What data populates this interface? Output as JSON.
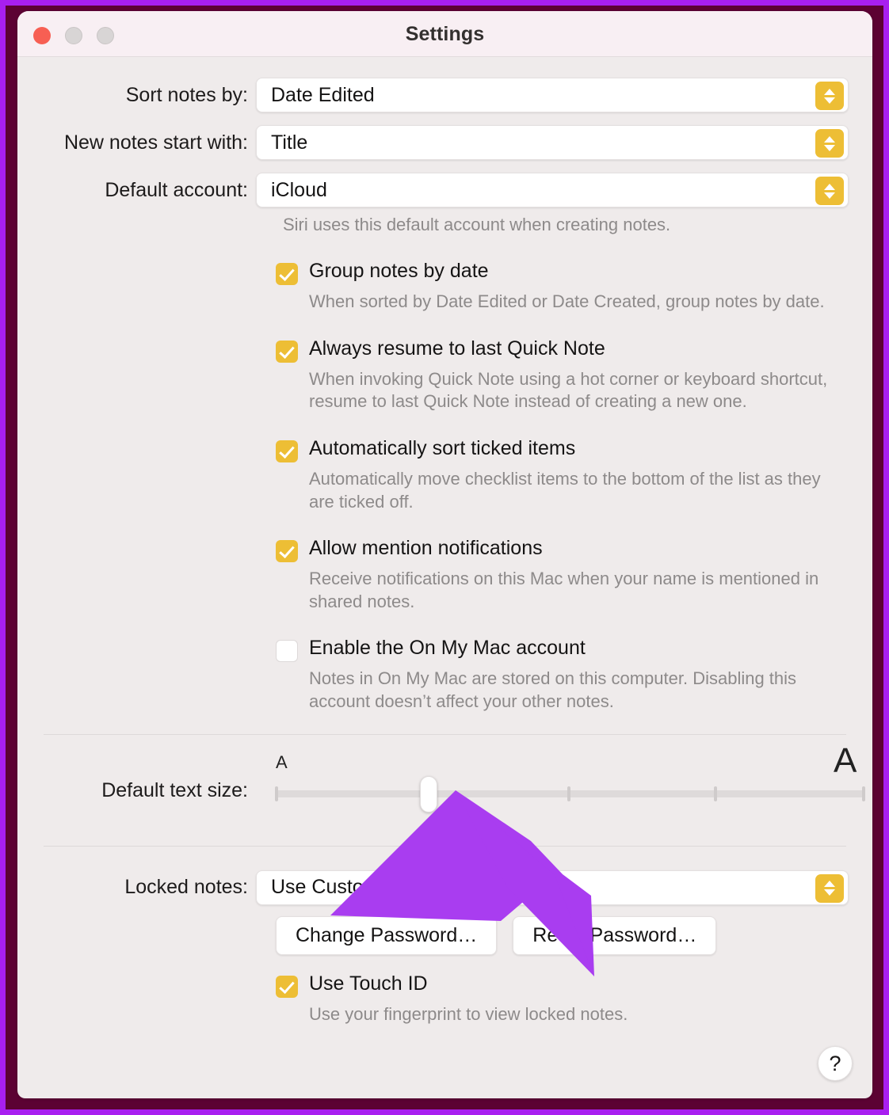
{
  "window": {
    "title": "Settings",
    "traffic_lights": [
      "close",
      "minimize",
      "maximize"
    ]
  },
  "popups": [
    {
      "label": "Sort notes by:",
      "value": "Date Edited"
    },
    {
      "label": "New notes start with:",
      "value": "Title"
    },
    {
      "label": "Default account:",
      "value": "iCloud"
    }
  ],
  "account_helper": "Siri uses this default account when creating notes.",
  "checkboxes": [
    {
      "label": "Group notes by date",
      "checked": true,
      "description": "When sorted by Date Edited or Date Created, group notes by date."
    },
    {
      "label": "Always resume to last Quick Note",
      "checked": true,
      "description": "When invoking Quick Note using a hot corner or keyboard shortcut, resume to last Quick Note instead of creating a new one."
    },
    {
      "label": "Automatically sort ticked items",
      "checked": true,
      "description": "Automatically move checklist items to the bottom of the list as they are ticked off."
    },
    {
      "label": "Allow mention notifications",
      "checked": true,
      "description": "Receive notifications on this Mac when your name is mentioned in shared notes."
    },
    {
      "label": "Enable the On My Mac account",
      "checked": false,
      "description": "Notes in On My Mac are stored on this computer. Disabling this account doesn’t affect your other notes."
    }
  ],
  "text_size": {
    "label": "Default text size:",
    "small_mark": "A",
    "large_mark": "A",
    "value_percent": 25,
    "tick_count": 4
  },
  "locked_notes": {
    "label": "Locked notes:",
    "value": "Use Custom Password",
    "change_password_label": "Change Password…",
    "reset_password_label": "Reset Password…",
    "touch_id_label": "Use Touch ID",
    "touch_id_checked": true,
    "touch_id_description": "Use your fingerprint to view locked notes."
  },
  "help_button_label": "?",
  "colors": {
    "accent_gold": "#edbe35",
    "annotation_purple": "#a93df0",
    "frame_outer": "#a81ff0",
    "frame_inner": "#5c0233",
    "window_bg": "#efebeb",
    "titlebar_bg": "#f8eff3",
    "close_light": "#f75f53",
    "inactive_light": "#d8d5d5"
  }
}
